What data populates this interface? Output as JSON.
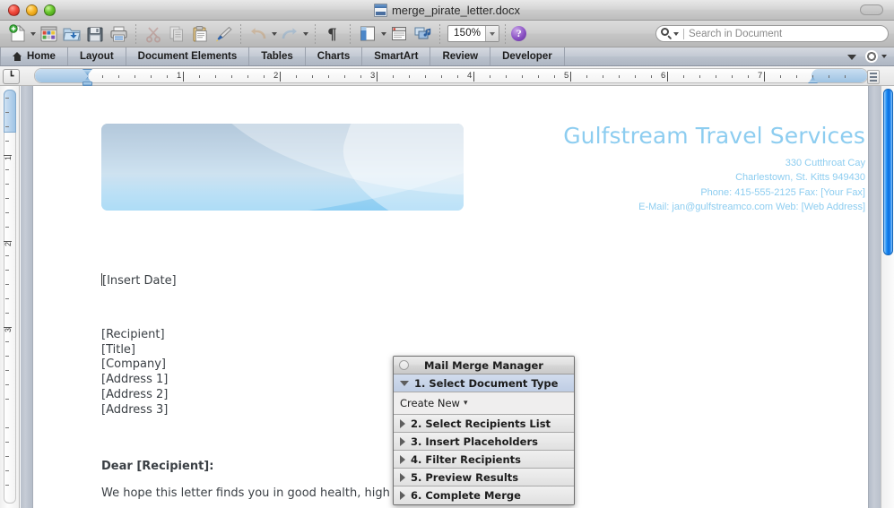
{
  "window": {
    "title": "merge_pirate_letter.docx",
    "doc_icon": "docx-file-icon",
    "traffic_lights": [
      "close",
      "minimize",
      "zoom"
    ]
  },
  "toolbar": {
    "items": [
      {
        "name": "new-document-button",
        "icon": "new-document-icon",
        "has_menu": true
      },
      {
        "name": "new-from-template-button",
        "icon": "template-gallery-icon",
        "has_menu": false
      },
      {
        "name": "open-button",
        "icon": "open-folder-icon",
        "has_menu": false
      },
      {
        "name": "save-button",
        "icon": "floppy-disk-icon",
        "has_menu": false
      },
      {
        "name": "print-button",
        "icon": "printer-icon",
        "has_menu": false
      },
      {
        "name": "cut-button",
        "icon": "scissors-icon",
        "has_menu": false
      },
      {
        "name": "copy-button",
        "icon": "copy-pages-icon",
        "has_menu": false
      },
      {
        "name": "paste-button",
        "icon": "clipboard-icon",
        "has_menu": false
      },
      {
        "name": "format-painter-button",
        "icon": "paintbrush-icon",
        "has_menu": false
      },
      {
        "name": "undo-button",
        "icon": "undo-arrow-icon",
        "has_menu": true
      },
      {
        "name": "redo-button",
        "icon": "redo-arrow-icon",
        "has_menu": true
      },
      {
        "name": "show-formatting-button",
        "icon": "pilcrow-icon",
        "has_menu": false
      },
      {
        "name": "sidebar-toggle-button",
        "icon": "sidebar-panel-icon",
        "has_menu": true
      },
      {
        "name": "notebook-layout-button",
        "icon": "notebook-icon",
        "has_menu": false
      },
      {
        "name": "media-browser-button",
        "icon": "media-browser-icon",
        "has_menu": false
      }
    ],
    "zoom_value": "150%",
    "help_label": "?"
  },
  "search": {
    "placeholder": "Search in Document",
    "value": "",
    "icon": "search-magnifier-icon"
  },
  "ribbon": {
    "tabs": [
      {
        "label": "Home",
        "icon": "home-icon",
        "active": false
      },
      {
        "label": "Layout",
        "icon": "",
        "active": false
      },
      {
        "label": "Document Elements",
        "icon": "",
        "active": false
      },
      {
        "label": "Tables",
        "icon": "",
        "active": false
      },
      {
        "label": "Charts",
        "icon": "",
        "active": false
      },
      {
        "label": "SmartArt",
        "icon": "",
        "active": false
      },
      {
        "label": "Review",
        "icon": "",
        "active": false
      },
      {
        "label": "Developer",
        "icon": "",
        "active": false
      }
    ],
    "collapse_icon": "chevron-down-icon",
    "options_icon": "gear-icon"
  },
  "ruler": {
    "horizontal_labels": [
      "1",
      "2",
      "3",
      "4",
      "5",
      "6",
      "7"
    ],
    "vertical_labels": [
      "1",
      "2",
      "3"
    ],
    "tab_selector_glyph": "┗"
  },
  "document": {
    "header": {
      "company": "Gulfstream Travel Services",
      "address_line_1": "330 Cutthroat Cay",
      "address_line_2": "Charlestown, St. Kitts 949430",
      "address_line_3": "Phone: 415-555-2125  Fax: [Your Fax]",
      "address_line_4": "E-Mail: jan@gulfstreamco.com  Web: [Web Address]",
      "banner_image": "blue-swoosh-banner"
    },
    "date_placeholder": "[Insert Date]",
    "recipient_block": [
      "[Recipient]",
      "[Title]",
      "[Company]",
      "[Address 1]",
      "[Address 2]",
      "[Address 3]"
    ],
    "salutation": "Dear [Recipient]:",
    "paragraph_1": "We hope this letter finds you in good health, high spirits and with a heavy purse."
  },
  "mail_merge_manager": {
    "title": "Mail Merge Manager",
    "close_icon": "close-circle-icon",
    "steps": [
      {
        "label": "1. Select Document Type",
        "expanded": true,
        "arrow": "triangle-down-icon"
      },
      {
        "label": "2. Select Recipients List",
        "expanded": false,
        "arrow": "triangle-right-icon"
      },
      {
        "label": "3. Insert Placeholders",
        "expanded": false,
        "arrow": "triangle-right-icon"
      },
      {
        "label": "4. Filter Recipients",
        "expanded": false,
        "arrow": "triangle-right-icon"
      },
      {
        "label": "5. Preview Results",
        "expanded": false,
        "arrow": "triangle-right-icon"
      },
      {
        "label": "6. Complete Merge",
        "expanded": false,
        "arrow": "triangle-right-icon"
      }
    ],
    "create_new_label": "Create New",
    "create_new_caret": "▾"
  },
  "colors": {
    "accent_blue": "#8dcdf0",
    "scrollbar_blue": "#1c84ef",
    "panel_active": "#bfcde4",
    "body_text": "#3a3f44"
  }
}
